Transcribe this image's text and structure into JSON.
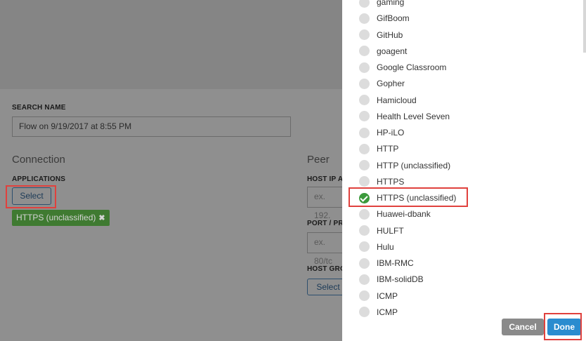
{
  "form": {
    "search_name_label": "SEARCH NAME",
    "search_name_value": "Flow on 9/19/2017 at 8:55 PM",
    "connection_heading": "Connection",
    "applications_label": "APPLICATIONS",
    "select_label": "Select",
    "selected_tag": "HTTPS (unclassified)",
    "tag_remove_glyph": "✖",
    "peer_heading": "Peer",
    "host_ip_label": "HOST IP A",
    "host_ip_placeholder": "ex. 192.",
    "port_label": "PORT / PR",
    "port_placeholder": "ex. 80/tc",
    "host_group_label": "HOST GRO",
    "host_group_select_label": "Select"
  },
  "app_list": {
    "items": [
      {
        "label": "gaming",
        "checked": false
      },
      {
        "label": "GifBoom",
        "checked": false
      },
      {
        "label": "GitHub",
        "checked": false
      },
      {
        "label": "goagent",
        "checked": false
      },
      {
        "label": "Google Classroom",
        "checked": false
      },
      {
        "label": "Gopher",
        "checked": false
      },
      {
        "label": "Hamicloud",
        "checked": false
      },
      {
        "label": "Health Level Seven",
        "checked": false
      },
      {
        "label": "HP-iLO",
        "checked": false
      },
      {
        "label": "HTTP",
        "checked": false
      },
      {
        "label": "HTTP (unclassified)",
        "checked": false
      },
      {
        "label": "HTTPS",
        "checked": false
      },
      {
        "label": "HTTPS (unclassified)",
        "checked": true
      },
      {
        "label": "Huawei-dbank",
        "checked": false
      },
      {
        "label": "HULFT",
        "checked": false
      },
      {
        "label": "Hulu",
        "checked": false
      },
      {
        "label": "IBM-RMC",
        "checked": false
      },
      {
        "label": "IBM-solidDB",
        "checked": false
      },
      {
        "label": "ICMP",
        "checked": false
      },
      {
        "label": "ICMP",
        "checked": false
      }
    ],
    "cancel_label": "Cancel",
    "done_label": "Done"
  },
  "colors": {
    "accent": "#2a8ccf",
    "selected_tag": "#3f7a31",
    "checked_radio": "#3c9a3c",
    "highlight_box": "#e0413d"
  }
}
